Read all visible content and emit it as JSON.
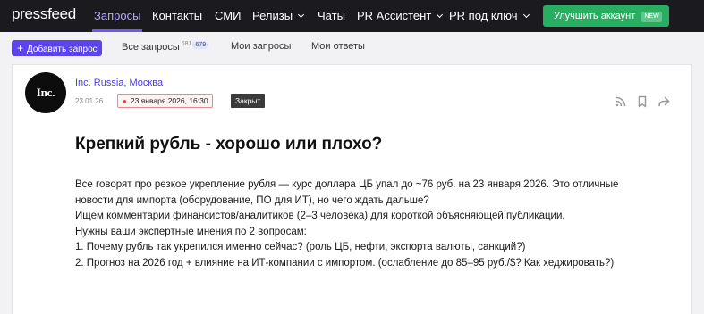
{
  "brand": {
    "logo": "pressfeed"
  },
  "topnav": {
    "items": [
      {
        "label": "Запросы",
        "active": true
      },
      {
        "label": "Контакты"
      },
      {
        "label": "СМИ"
      },
      {
        "label": "Релизы",
        "has_dropdown": true
      },
      {
        "label": "Чаты"
      },
      {
        "label": "PR Ассистент",
        "has_dropdown": true
      },
      {
        "label": "PR под ключ",
        "has_dropdown": true
      }
    ],
    "upgrade": {
      "label": "Улучшить аккаунт",
      "badge": "NEW"
    }
  },
  "subnav": {
    "add_button": "Добавить запрос",
    "tabs": [
      {
        "label": "Все запросы",
        "count": "681",
        "badge": "679"
      },
      {
        "label": "Мои запросы"
      },
      {
        "label": "Мои ответы"
      }
    ]
  },
  "request": {
    "avatar_text": "Inc.",
    "company": "Inc. Russia, Москва",
    "published": "23.01.26",
    "deadline": "23 января 2026, 16:30",
    "status": "Закрыт",
    "actions": [
      "rss-icon",
      "bookmark-icon",
      "share-icon"
    ],
    "title": "Крепкий рубль - хорошо или плохо?",
    "body": [
      "Все говорят про резкое укрепление рубля — курс доллара ЦБ упал до ~76 руб. на 23 января 2026. Это отличные новости для импорта (оборудование, ПО для ИТ), но чего ждать дальше?",
      "Ищем комментарии финансистов/аналитиков (2–3 человека) для короткой объясняющей публикации.",
      "Нужны ваши экспертные мнения по 2 вопросам:",
      "1. Почему рубль так укрепился именно сейчас? (роль ЦБ, нефти, экспорта валюты, санкций?)",
      "2. Прогноз на 2026 год + влияние на ИТ-компании с импортом. (ослабление до 85–95 руб./$? Как хеджировать?)"
    ]
  },
  "colors": {
    "navbar": "#1b1b1f",
    "accent": "#5b44ec",
    "upgrade": "#27ae60",
    "company_link": "#4a3be0",
    "deadline_border": "#e58b8b",
    "status_bg": "#3b3b3b"
  }
}
